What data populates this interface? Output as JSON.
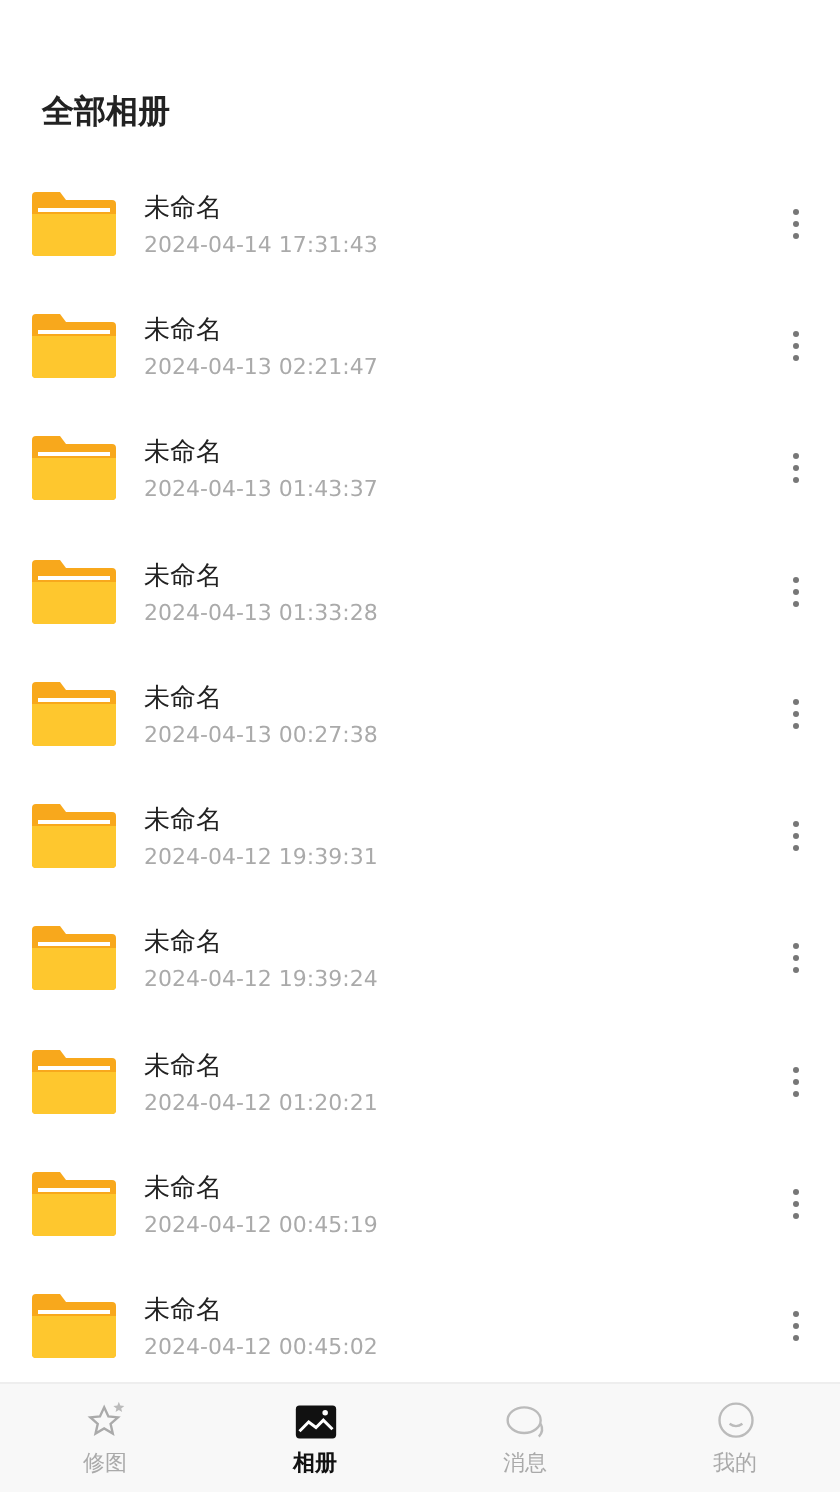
{
  "title": "全部相册",
  "albums": [
    {
      "name": "未命名",
      "date": "2024-04-14 17:31:43"
    },
    {
      "name": "未命名",
      "date": "2024-04-13 02:21:47"
    },
    {
      "name": "未命名",
      "date": "2024-04-13 01:43:37"
    },
    {
      "name": "未命名",
      "date": "2024-04-13 01:33:28"
    },
    {
      "name": "未命名",
      "date": "2024-04-13 00:27:38"
    },
    {
      "name": "未命名",
      "date": "2024-04-12 19:39:31"
    },
    {
      "name": "未命名",
      "date": "2024-04-12 19:39:24"
    },
    {
      "name": "未命名",
      "date": "2024-04-12 01:20:21"
    },
    {
      "name": "未命名",
      "date": "2024-04-12 00:45:19"
    },
    {
      "name": "未命名",
      "date": "2024-04-12 00:45:02"
    }
  ],
  "tabs": [
    {
      "kind": "star",
      "label": "修图",
      "selected": false
    },
    {
      "kind": "picture",
      "label": "相册",
      "selected": true
    },
    {
      "kind": "chat",
      "label": "消息",
      "selected": false
    },
    {
      "kind": "face",
      "label": "我的",
      "selected": false
    }
  ]
}
